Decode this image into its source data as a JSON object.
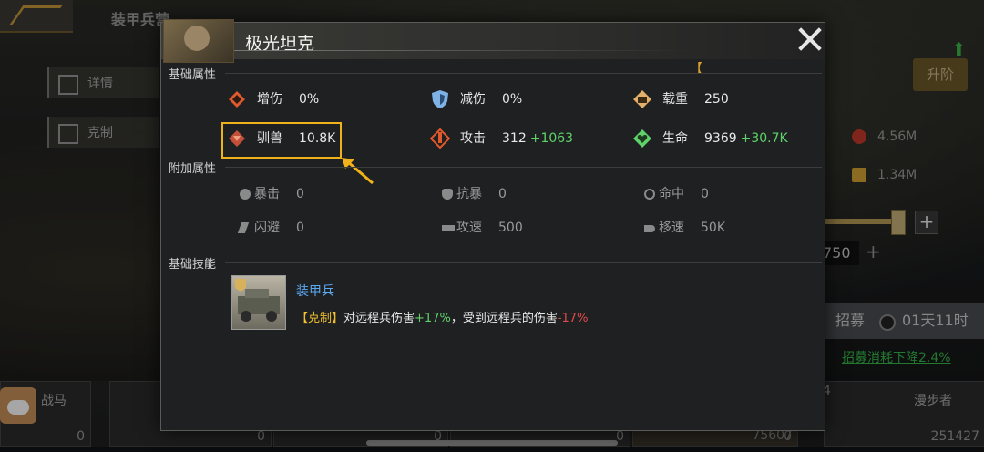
{
  "background": {
    "title": "装甲兵营",
    "side_buttons": [
      "详情",
      "克制"
    ],
    "upgrade_label": "升阶",
    "resources": [
      "4.56M",
      "1.34M"
    ],
    "count": "750",
    "recruit": {
      "label": "招募",
      "time": "01天11时"
    },
    "recruit_note": "招募消耗下降2.4%",
    "cards": [
      {
        "name": "战马",
        "value": "0"
      },
      {
        "name": "",
        "value": "0"
      },
      {
        "name": "",
        "value": "0"
      },
      {
        "name": "",
        "value": "0"
      },
      {
        "name": "",
        "value": "0"
      },
      {
        "name": "",
        "value": "75607"
      },
      {
        "name": "漫步者",
        "value": "251427"
      }
    ],
    "card_prefix": "4"
  },
  "modal": {
    "title": "极光坦克",
    "bracket": "【",
    "sections": {
      "basic": "基础属性",
      "extra": "附加属性",
      "skill": "基础技能"
    },
    "basic_stats": [
      {
        "name": "增伤",
        "value": "0%",
        "bonus": "",
        "icon": "damage-boost-icon",
        "color": "#e0592c"
      },
      {
        "name": "减伤",
        "value": "0%",
        "bonus": "",
        "icon": "shield-icon",
        "color": "#7fb3e6"
      },
      {
        "name": "载重",
        "value": "250",
        "bonus": "",
        "icon": "cargo-icon",
        "color": "#e2b06a"
      },
      {
        "name": "驯兽",
        "value": "10.8K",
        "bonus": "",
        "icon": "beast-tame-icon",
        "color": "#e06a4a"
      },
      {
        "name": "攻击",
        "value": "312",
        "bonus": "+1063",
        "icon": "attack-icon",
        "color": "#e0592c"
      },
      {
        "name": "生命",
        "value": "9369",
        "bonus": "+30.7K",
        "icon": "health-icon",
        "color": "#5fd36a"
      }
    ],
    "extra_stats": [
      {
        "name": "暴击",
        "value": "0",
        "icon": "crit-icon"
      },
      {
        "name": "抗暴",
        "value": "0",
        "icon": "crit-resist-icon"
      },
      {
        "name": "命中",
        "value": "0",
        "icon": "accuracy-icon"
      },
      {
        "name": "闪避",
        "value": "0",
        "icon": "dodge-icon"
      },
      {
        "name": "攻速",
        "value": "500",
        "icon": "attack-speed-icon"
      },
      {
        "name": "移速",
        "value": "50K",
        "icon": "move-speed-icon"
      }
    ],
    "skill": {
      "name": "装甲兵",
      "desc_tag": "【克制】",
      "desc_1": "对远程兵伤害",
      "desc_up": "+17%",
      "desc_2": "，受到远程兵的伤害",
      "desc_down": "-17%"
    }
  }
}
